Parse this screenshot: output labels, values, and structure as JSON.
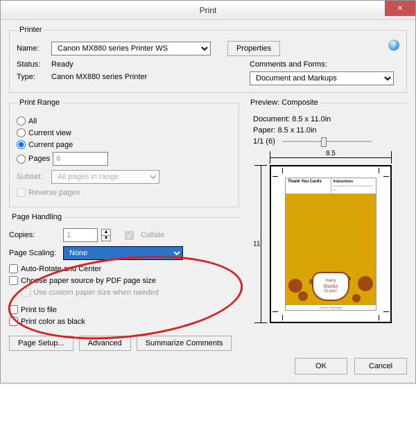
{
  "window": {
    "title": "Print"
  },
  "printer": {
    "legend": "Printer",
    "name_label": "Name:",
    "name_value": "Canon MX880 series Printer WS",
    "properties_btn": "Properties",
    "status_label": "Status:",
    "status_value": "Ready",
    "type_label": "Type:",
    "type_value": "Canon MX880 series Printer",
    "comments_label": "Comments and Forms:",
    "comments_value": "Document and Markups",
    "help_tooltip": "?"
  },
  "range": {
    "legend": "Print Range",
    "all": "All",
    "current_view": "Current view",
    "current_page": "Current page",
    "pages": "Pages",
    "pages_value": "6",
    "subset_label": "Subset:",
    "subset_value": "All pages in range",
    "reverse": "Reverse pages"
  },
  "handling": {
    "legend": "Page Handling",
    "copies_label": "Copies:",
    "copies_value": "1",
    "collate": "Collate",
    "scaling_label": "Page Scaling:",
    "scaling_value": "None",
    "auto_rotate": "Auto-Rotate and Center",
    "paper_source": "Choose paper source by PDF page size",
    "custom_paper": "Use custom paper size when needed"
  },
  "misc": {
    "print_to_file": "Print to file",
    "print_color_black": "Print color as black"
  },
  "preview": {
    "legend": "Preview: Composite",
    "doc_label": "Document: 8.5 x 11.0in",
    "paper_label": "Paper: 8.5 x 11.0in",
    "zoom": "1/1 (6)",
    "dim_w": "8.5",
    "dim_h": "11",
    "card_title": "Thank You Cards",
    "instr_title": "Instructions",
    "medallion_l1": "many",
    "medallion_l2": "thanks",
    "medallion_l3": "to you!",
    "footer": "©Press Print Party"
  },
  "bottom": {
    "page_setup": "Page Setup...",
    "advanced": "Advanced",
    "summarize": "Summarize Comments"
  },
  "dialog": {
    "ok": "OK",
    "cancel": "Cancel"
  }
}
